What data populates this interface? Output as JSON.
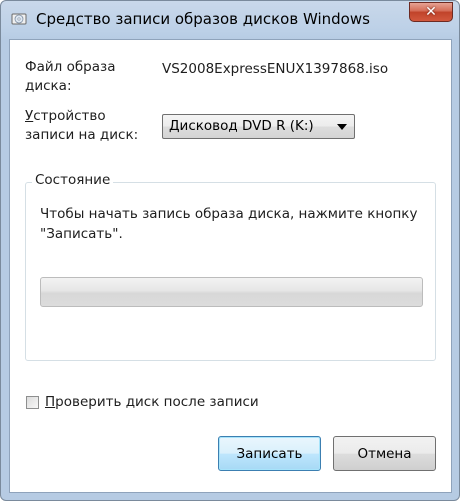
{
  "window": {
    "title": "Средство записи образов дисков Windows",
    "close_glyph": "✕",
    "icon": "disc-burner-icon"
  },
  "image_file": {
    "label": "Файл образа диска:",
    "value": "VS2008ExpressENUX1397868.iso"
  },
  "burner": {
    "label": "Устройство записи на диск:",
    "selected": "Дисковод DVD R (K:)"
  },
  "status": {
    "title": "Состояние",
    "message": "Чтобы начать запись образа диска, нажмите кнопку \"Записать\".",
    "progress_percent": 0
  },
  "verify": {
    "label": "Проверить диск после записи",
    "checked": false
  },
  "buttons": {
    "write": "Записать",
    "cancel": "Отмена"
  },
  "colors": {
    "title_bar": "#bcd0e7",
    "close_button": "#c7462f",
    "default_button_border": "#3c7fb1"
  }
}
